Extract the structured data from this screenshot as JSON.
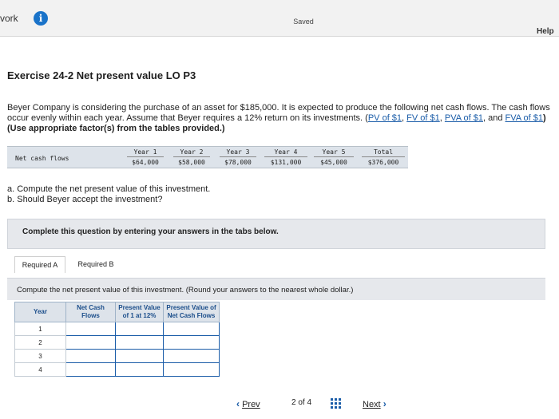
{
  "topbar": {
    "app_label": "vork",
    "saved": "Saved",
    "help": "Help"
  },
  "exercise": {
    "title": "Exercise 24-2 Net present value LO P3",
    "desc_main": "Beyer Company is considering the purchase of an asset for $185,000. It is expected to produce the following net cash flows. The cash flows occur evenly within each year. Assume that Beyer requires a 12% return on its investments. ",
    "link_open": "(",
    "links": [
      "PV of $1",
      "FV of $1",
      "PVA of $1",
      "FVA of $1"
    ],
    "link_sep": ", ",
    "link_and": ", and ",
    "link_close": ")",
    "desc_bold": " (Use appropriate factor(s) from the tables provided.)"
  },
  "cash_flows": {
    "row_label": "Net cash flows",
    "headers": [
      "Year 1",
      "Year 2",
      "Year 3",
      "Year 4",
      "Year 5",
      "Total"
    ],
    "values": [
      "$64,000",
      "$58,000",
      "$78,000",
      "$131,000",
      "$45,000",
      "$376,000"
    ]
  },
  "questions": {
    "a": "a. Compute the net present value of this investment.",
    "b": "b. Should Beyer accept the investment?"
  },
  "complete_prompt": "Complete this question by entering your answers in the tabs below.",
  "tabs": [
    "Required A",
    "Required B"
  ],
  "subquestion": "Compute the net present value of this investment. (Round your answers to the nearest whole dollar.)",
  "answer_table": {
    "headers": [
      "Year",
      "Net Cash Flows",
      "Present Value of 1 at 12%",
      "Present Value of Net Cash Flows"
    ],
    "years": [
      "1",
      "2",
      "3",
      "4"
    ]
  },
  "nav": {
    "prev": "Prev",
    "page": "2 of 4",
    "next": "Next"
  },
  "colors": {
    "link": "#1a5ca8",
    "accent": "#1a73c9",
    "panel": "#e6e8ec"
  },
  "icons": {
    "info": "info-icon",
    "grid": "grid-icon",
    "prev": "chevron-left-icon",
    "next": "chevron-right-icon"
  }
}
